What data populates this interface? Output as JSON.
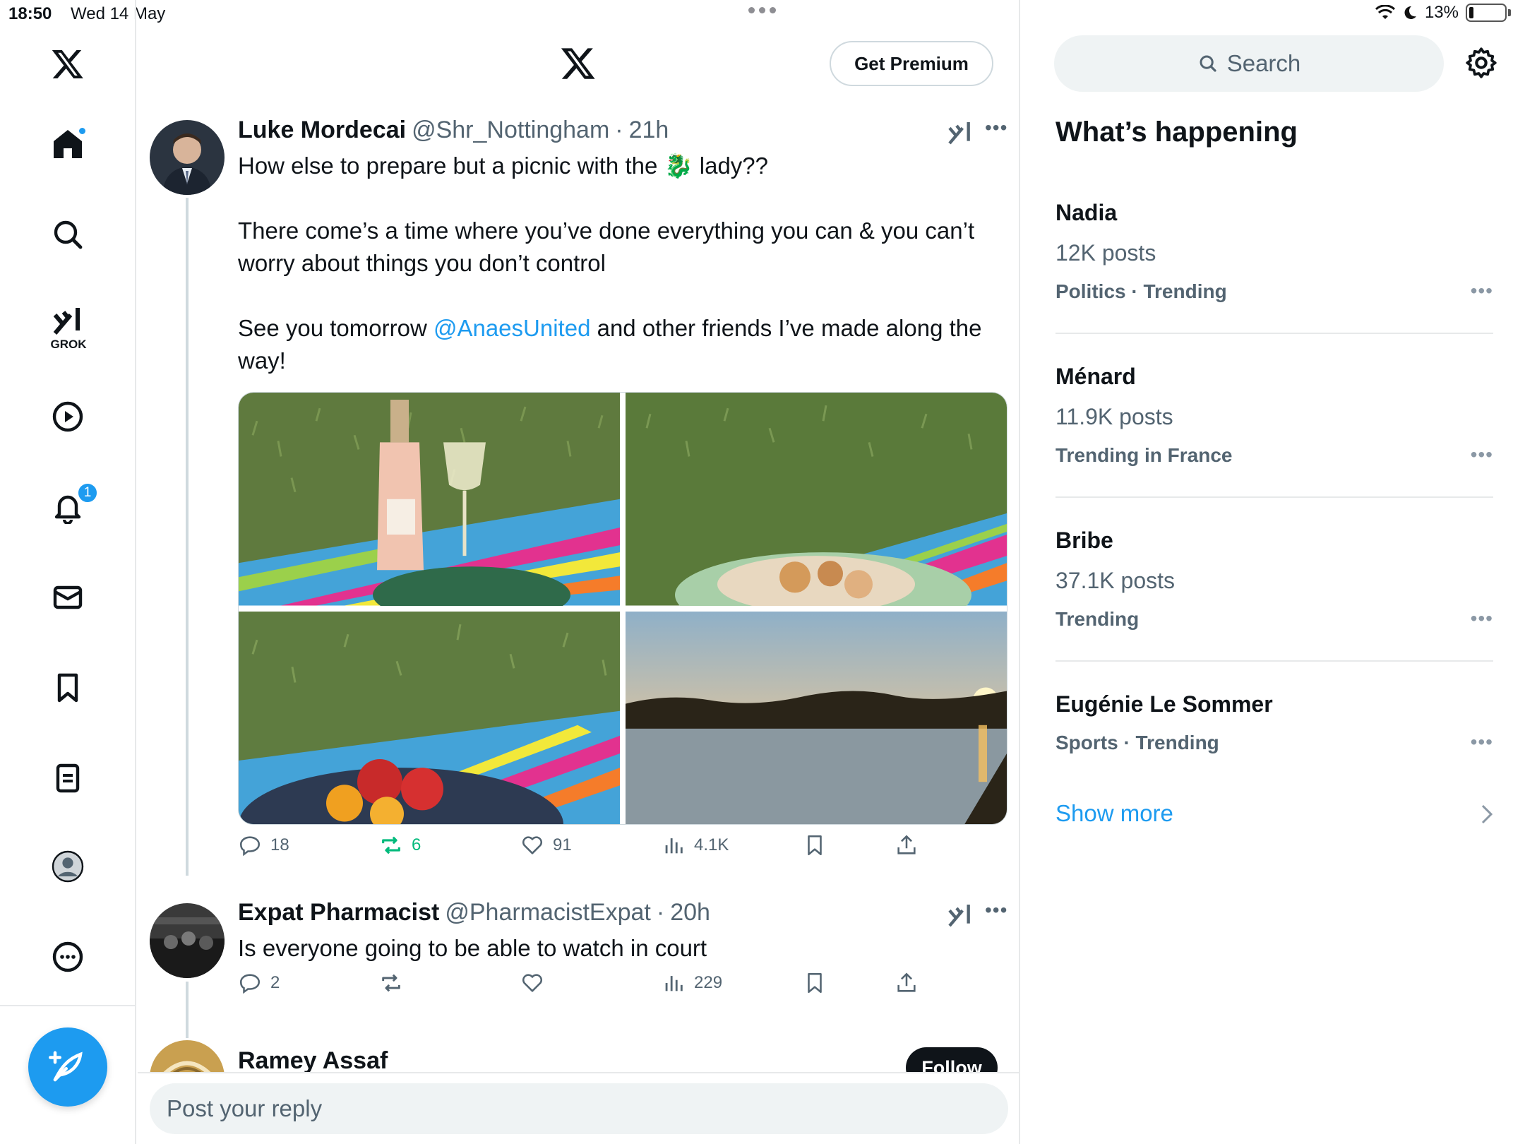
{
  "status_bar": {
    "time": "18:50",
    "date": "Wed 14 May",
    "battery": "13%"
  },
  "nav": {
    "items": [
      {
        "name": "home",
        "icon": "home-icon",
        "has_dot": true
      },
      {
        "name": "explore",
        "icon": "search-icon"
      },
      {
        "name": "grok",
        "icon": "grok-icon",
        "label": "GROK"
      },
      {
        "name": "videos",
        "icon": "play-icon"
      },
      {
        "name": "notifications",
        "icon": "bell-icon",
        "badge": "1"
      },
      {
        "name": "messages",
        "icon": "mail-icon"
      },
      {
        "name": "bookmarks",
        "icon": "bookmark-icon"
      },
      {
        "name": "lists",
        "icon": "list-icon"
      },
      {
        "name": "profile",
        "icon": "avatar-icon"
      },
      {
        "name": "more",
        "icon": "more-circle-icon"
      }
    ],
    "compose_icon": "compose-feather-icon"
  },
  "header": {
    "logo": "x-logo-icon",
    "premium_label": "Get Premium"
  },
  "posts": [
    {
      "name": "Luke Mordecai",
      "handle": "@Shr_Nottingham",
      "time": "21h",
      "text1": "How else to prepare but a picnic with the ",
      "emoji": "🐉",
      "text1b": " lady??",
      "text2": "There come’s a time where you’ve done everything you can & you can’t worry about things you don’t control",
      "text3a": "See you tomorrow ",
      "mention": "@AnaesUnited",
      "text3b": " and other friends I’ve made along the way!",
      "media": [
        "picnic-wine-photo",
        "picnic-salad-photo",
        "picnic-strawberries-photo",
        "river-sunset-photo"
      ],
      "stats": {
        "replies": "18",
        "reposts": "6",
        "likes": "91",
        "views": "4.1K"
      }
    },
    {
      "name": "Expat Pharmacist",
      "handle": "@PharmacistExpat",
      "time": "20h",
      "text": "Is everyone going to be able to watch in court",
      "stats": {
        "replies": "2",
        "reposts": "",
        "likes": "",
        "views": "229"
      }
    },
    {
      "name": "Ramey Assaf",
      "follow_label": "Follow"
    }
  ],
  "reply": {
    "placeholder": "Post your reply"
  },
  "sidebar": {
    "search_placeholder": "Search",
    "title": "What’s happening",
    "trends": [
      {
        "name": "Nadia",
        "posts": "12K posts",
        "meta": "Politics · Trending"
      },
      {
        "name": "Ménard",
        "posts": "11.9K posts",
        "meta": "Trending in France"
      },
      {
        "name": "Bribe",
        "posts": "37.1K posts",
        "meta": "Trending"
      },
      {
        "name": "Eugénie Le Sommer",
        "posts": "",
        "meta": "Sports · Trending"
      }
    ],
    "show_more": "Show more"
  },
  "colors": {
    "accent": "#1d9bf0",
    "text": "#0f1419",
    "secondary": "#536471",
    "repost_green": "#00ba7c",
    "border": "#e7e9ea"
  }
}
